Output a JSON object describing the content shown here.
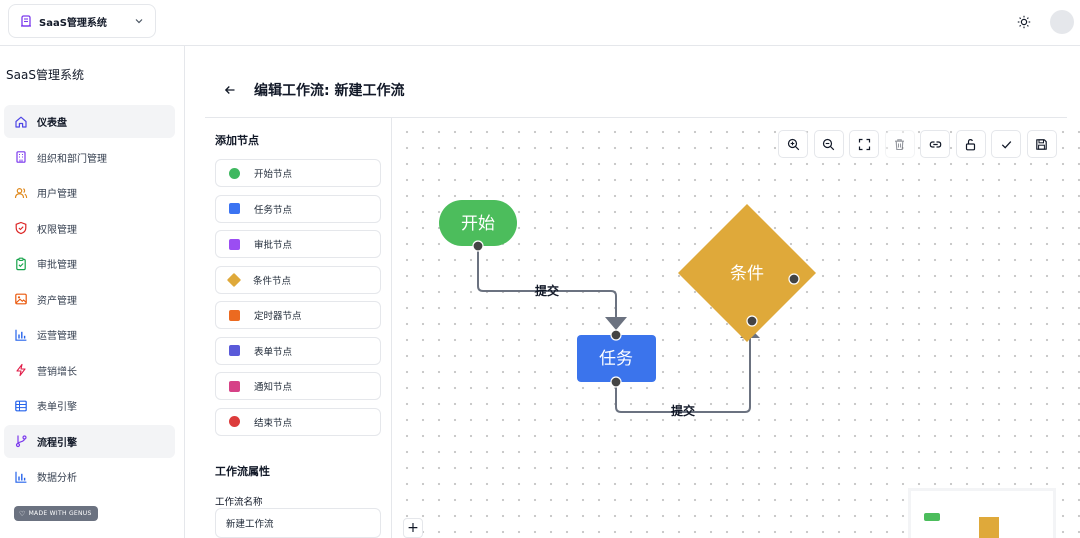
{
  "app": {
    "name": "SaaS管理系统"
  },
  "sidebar": {
    "title": "SaaS管理系统",
    "items": [
      {
        "label": "仪表盘",
        "icon": "home-icon",
        "active": true
      },
      {
        "label": "组织和部门管理",
        "icon": "building-icon",
        "active": false
      },
      {
        "label": "用户管理",
        "icon": "users-icon",
        "active": false
      },
      {
        "label": "权限管理",
        "icon": "shield-icon",
        "active": false
      },
      {
        "label": "审批管理",
        "icon": "clipboard-check-icon",
        "active": false
      },
      {
        "label": "资产管理",
        "icon": "image-icon",
        "active": false
      },
      {
        "label": "运营管理",
        "icon": "bar-chart-icon",
        "active": false
      },
      {
        "label": "营销增长",
        "icon": "lightning-icon",
        "active": false
      },
      {
        "label": "表单引擎",
        "icon": "table-icon",
        "active": false
      },
      {
        "label": "流程引擎",
        "icon": "git-branch-icon",
        "active": true
      },
      {
        "label": "数据分析",
        "icon": "bar-chart-icon",
        "active": false
      }
    ],
    "badge": "MADE WITH GENUS"
  },
  "header": {
    "title": "编辑工作流: 新建工作流"
  },
  "node_panel": {
    "heading": "添加节点",
    "items": [
      {
        "label": "开始节点",
        "color": "#3fb860",
        "shape": "circle"
      },
      {
        "label": "任务节点",
        "color": "#3b73f2",
        "shape": "square"
      },
      {
        "label": "审批节点",
        "color": "#9b4df2",
        "shape": "square"
      },
      {
        "label": "条件节点",
        "color": "#dfa93a",
        "shape": "diamond"
      },
      {
        "label": "定时器节点",
        "color": "#ec6a20",
        "shape": "square"
      },
      {
        "label": "表单节点",
        "color": "#5a5ad9",
        "shape": "square"
      },
      {
        "label": "通知节点",
        "color": "#d64287",
        "shape": "square"
      },
      {
        "label": "结束节点",
        "color": "#dc3b3b",
        "shape": "circle"
      }
    ],
    "props_heading": "工作流属性",
    "name_label": "工作流名称",
    "name_value": "新建工作流"
  },
  "canvas": {
    "toolbar": [
      {
        "name": "zoom-in-icon",
        "disabled": false
      },
      {
        "name": "zoom-out-icon",
        "disabled": false
      },
      {
        "name": "fit-view-icon",
        "disabled": false
      },
      {
        "name": "trash-icon",
        "disabled": true
      },
      {
        "name": "link-icon",
        "disabled": false
      },
      {
        "name": "unlock-icon",
        "disabled": false
      },
      {
        "name": "check-icon",
        "disabled": false
      },
      {
        "name": "save-icon",
        "disabled": false
      }
    ],
    "nodes": {
      "start": {
        "label": "开始",
        "color": "#4cbd5c"
      },
      "task": {
        "label": "任务",
        "color": "#3b74ec"
      },
      "condition": {
        "label": "条件",
        "color": "#dfa93a"
      }
    },
    "edges": [
      {
        "label": "提交"
      },
      {
        "label": "提交"
      }
    ],
    "zoom_plus": "+"
  }
}
